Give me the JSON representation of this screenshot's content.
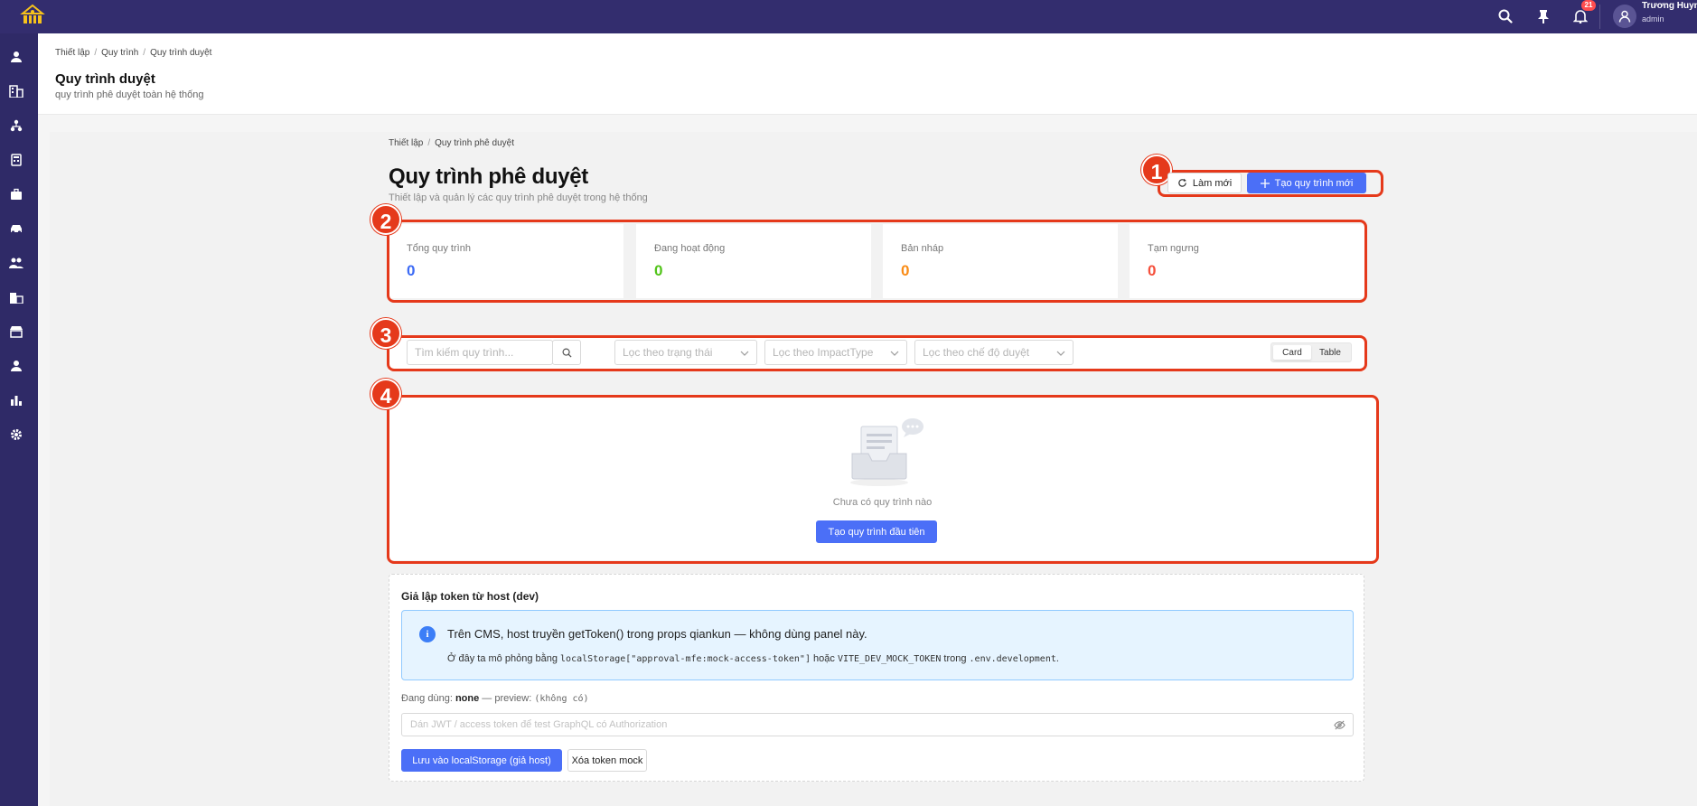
{
  "topbar": {
    "notification_count": "21",
    "user_name": "Trương Huyn",
    "user_role": "admin"
  },
  "header": {
    "breadcrumb": [
      "Thiết lập",
      "Quy trình",
      "Quy trình duyệt"
    ],
    "title": "Quy trình duyệt",
    "subtitle": "quy trình phê duyệt toàn hệ thống"
  },
  "main": {
    "breadcrumb": [
      "Thiết lập",
      "Quy trình phê duyệt"
    ],
    "title": "Quy trình phê duyệt",
    "subtitle": "Thiết lập và quản lý các quy trình phê duyệt trong hệ thống",
    "refresh_label": "Làm mới",
    "create_label": "Tạo quy trình mới"
  },
  "markers": [
    "1",
    "2",
    "3",
    "4"
  ],
  "stats": [
    {
      "label": "Tổng quy trình",
      "value": "0",
      "color": "#3d6bf5"
    },
    {
      "label": "Đang hoạt động",
      "value": "0",
      "color": "#52c41a"
    },
    {
      "label": "Bản nháp",
      "value": "0",
      "color": "#fa8c16"
    },
    {
      "label": "Tạm ngưng",
      "value": "0",
      "color": "#f5503c"
    }
  ],
  "filters": {
    "search_placeholder": "Tìm kiếm quy trình...",
    "status_placeholder": "Lọc theo trạng thái",
    "impact_placeholder": "Lọc theo ImpactType",
    "mode_placeholder": "Lọc theo chế độ duyệt",
    "view_card": "Card",
    "view_table": "Table",
    "active_view": "Card"
  },
  "empty": {
    "text": "Chưa có quy trình nào",
    "cta": "Tạo quy trình đầu tiên"
  },
  "dev_panel": {
    "title": "Giả lập token từ host (dev)",
    "info_line1": "Trên CMS, host truyền getToken() trong props qiankun — không dùng panel này.",
    "info_pre": "Ở đây ta mô phỏng bằng ",
    "info_code1": "localStorage[\"approval-mfe:mock-access-token\"]",
    "info_mid": " hoặc ",
    "info_code2": "VITE_DEV_MOCK_TOKEN",
    "info_mid2": " trong ",
    "info_code3": ".env.development",
    "info_end": ".",
    "using_label": "Đang dùng: ",
    "using_value": "none",
    "preview_label": " — preview: ",
    "preview_value": "(không có)",
    "token_placeholder": "Dán JWT / access token để test GraphQL có Authorization",
    "save_label": "Lưu vào localStorage (giả host)",
    "clear_label": "Xóa token mock"
  },
  "colors": {
    "topbar": "#332d6e",
    "sidebar": "#2f2a67",
    "primary": "#4b6ff7",
    "annotation": "#e5391b"
  },
  "icons": {
    "sidebar": [
      "user-icon",
      "building-icon",
      "org-icon",
      "calculator-icon",
      "briefcase-icon",
      "car-icon",
      "team-icon",
      "company-icon",
      "shop-icon",
      "user-setting-icon",
      "chart-icon",
      "settings-icon"
    ]
  }
}
